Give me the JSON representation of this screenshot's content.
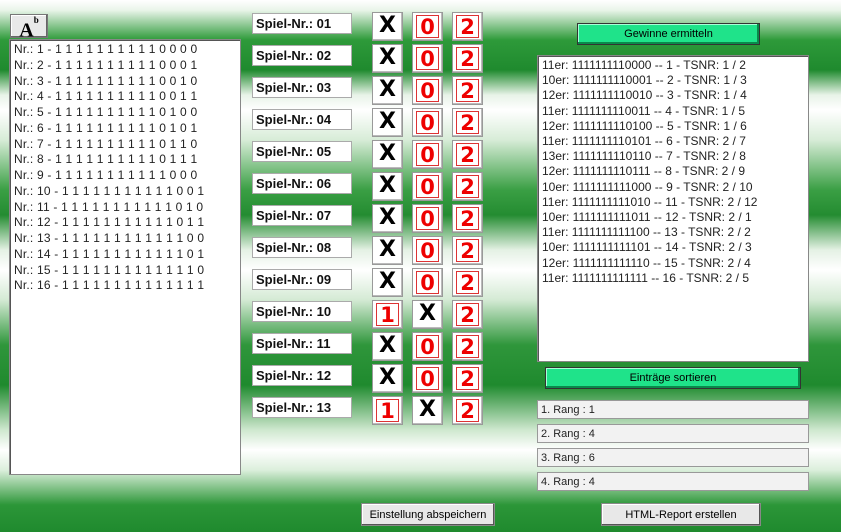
{
  "font_button": {
    "letter": "A",
    "sup": "b"
  },
  "left_list": [
    "Nr.: 1 - 1 1 1 1 1 1 1 1 1 1 0 0 0 0",
    "Nr.: 2 - 1 1 1 1 1 1 1 1 1 1 0 0 0 1",
    "Nr.: 3 - 1 1 1 1 1 1 1 1 1 1 0 0 1 0",
    "Nr.: 4 - 1 1 1 1 1 1 1 1 1 1 0 0 1 1",
    "Nr.: 5 - 1 1 1 1 1 1 1 1 1 1 0 1 0 0",
    "Nr.: 6 - 1 1 1 1 1 1 1 1 1 1 0 1 0 1",
    "Nr.: 7 - 1 1 1 1 1 1 1 1 1 1 0 1 1 0",
    "Nr.: 8 - 1 1 1 1 1 1 1 1 1 1 0 1 1 1",
    "Nr.: 9 - 1 1 1 1 1 1 1 1 1 1 1 0 0 0",
    "Nr.: 10 - 1 1 1 1 1 1 1 1 1 1 1 0 0 1",
    "Nr.: 11 - 1 1 1 1 1 1 1 1 1 1 1 0 1 0",
    "Nr.: 12 - 1 1 1 1 1 1 1 1 1 1 1 0 1 1",
    "Nr.: 13 - 1 1 1 1 1 1 1 1 1 1 1 1 0 0",
    "Nr.: 14 - 1 1 1 1 1 1 1 1 1 1 1 1 0 1",
    "Nr.: 15 - 1 1 1 1 1 1 1 1 1 1 1 1 1 0",
    "Nr.: 16 - 1 1 1 1 1 1 1 1 1 1 1 1 1 1"
  ],
  "games": [
    {
      "label": "Spiel-Nr.: 01",
      "crossed": "1"
    },
    {
      "label": "Spiel-Nr.: 02",
      "crossed": "1"
    },
    {
      "label": "Spiel-Nr.: 03",
      "crossed": "1"
    },
    {
      "label": "Spiel-Nr.: 04",
      "crossed": "1"
    },
    {
      "label": "Spiel-Nr.: 05",
      "crossed": "1"
    },
    {
      "label": "Spiel-Nr.: 06",
      "crossed": "1"
    },
    {
      "label": "Spiel-Nr.: 07",
      "crossed": "1"
    },
    {
      "label": "Spiel-Nr.: 08",
      "crossed": "1"
    },
    {
      "label": "Spiel-Nr.: 09",
      "crossed": "1"
    },
    {
      "label": "Spiel-Nr.: 10",
      "crossed": "0"
    },
    {
      "label": "Spiel-Nr.: 11",
      "crossed": "1"
    },
    {
      "label": "Spiel-Nr.: 12",
      "crossed": "1"
    },
    {
      "label": "Spiel-Nr.: 13",
      "crossed": "0"
    }
  ],
  "tip_symbols": [
    "1",
    "0",
    "2"
  ],
  "cross_symbol": "X",
  "buttons": {
    "gewinne": "Gewinne ermitteln",
    "sortieren": "Einträge sortieren",
    "abspeichern": "Einstellung abspeichern",
    "html_report": "HTML-Report erstellen"
  },
  "right_list": [
    "11er: 1111111110000 -- 1 - TSNR: 1 / 2",
    "10er: 1111111110001 -- 2 - TSNR: 1 / 3",
    "12er: 1111111110010 -- 3 - TSNR: 1 / 4",
    "11er: 1111111110011 -- 4 - TSNR: 1 / 5",
    "12er: 1111111110100 -- 5 - TSNR: 1 / 6",
    "11er: 1111111110101 -- 6 - TSNR: 2 / 7",
    "13er: 1111111110110 -- 7 - TSNR: 2 / 8",
    "12er: 1111111110111 -- 8 - TSNR: 2 / 9",
    "10er: 1111111111000 -- 9 - TSNR: 2 / 10",
    "11er: 1111111111010 -- 11 - TSNR: 2 / 12",
    "10er: 1111111111011 -- 12 - TSNR: 2 / 1",
    "11er: 1111111111100 -- 13 - TSNR: 2 / 2",
    "10er: 1111111111101 -- 14 - TSNR: 2 / 3",
    "12er: 1111111111110 -- 15 - TSNR: 2 / 4",
    "11er: 1111111111111 -- 16 - TSNR: 2 / 5"
  ],
  "ranks": [
    "1. Rang : 1",
    "2. Rang : 4",
    "3. Rang : 6",
    "4. Rang : 4"
  ],
  "colors": {
    "green_button": "#1fe38a",
    "symbol_red": "#e00000",
    "background_green": "#1f8a2e"
  }
}
